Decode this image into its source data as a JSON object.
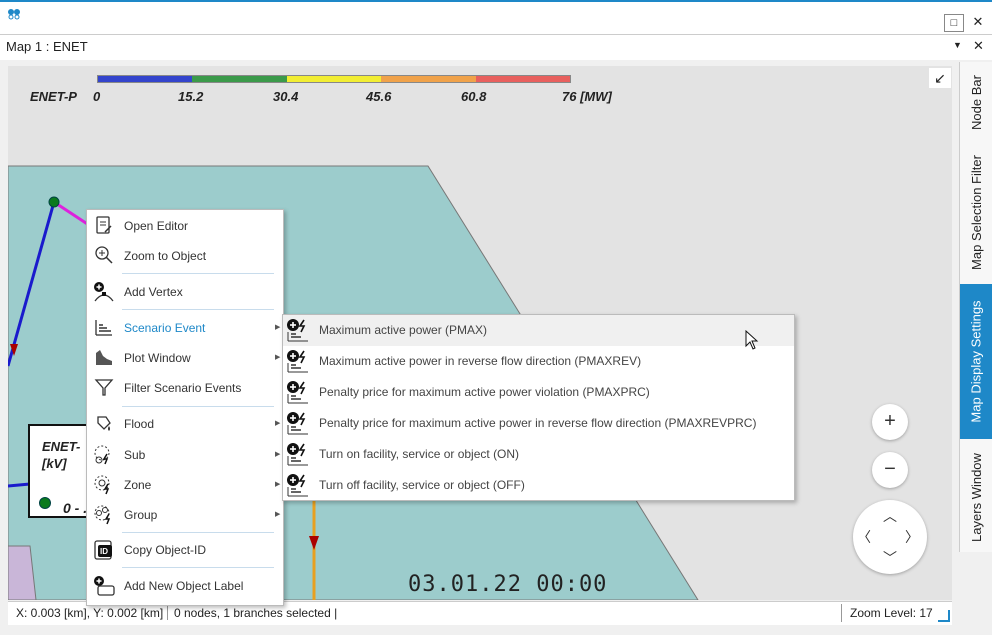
{
  "window": {
    "logo_text": "Int",
    "restore_label": "□",
    "close_label": "✕"
  },
  "document": {
    "title": "Map 1 : ENET",
    "dropdown": "▼",
    "close": "✕"
  },
  "legend": {
    "title": "ENET-P",
    "ticks": [
      "0",
      "15.2",
      "30.4",
      "45.6",
      "60.8",
      "76 [MW]"
    ],
    "colors": [
      "#3344cc",
      "#3b9a4a",
      "#f2ee33",
      "#f0a24a",
      "#e8605e"
    ]
  },
  "node_box": {
    "title_line1": "ENET-",
    "title_line2": "[kV]",
    "range": "0 - ..."
  },
  "map_controls": {
    "collapse_icon": "↙",
    "zoom_in": "+",
    "zoom_out": "−",
    "nav_up": "︿",
    "nav_down": "﹀",
    "nav_left": "〈",
    "nav_right": "〉"
  },
  "timestamp": "03.01.22 00:00",
  "status": {
    "coords": "X: 0.003 [km], Y: 0.002 [km]",
    "selection": "0 nodes, 1 branches selected  |",
    "zoom": "Zoom Level: 17"
  },
  "sidebar": {
    "tabs": [
      "Node Bar",
      "Map Selection Filter",
      "Map Display Settings",
      "Layers Window"
    ],
    "active": "Map Display Settings"
  },
  "context_menu": {
    "items": [
      {
        "label": "Open Editor",
        "icon": "editor-icon",
        "submenu": false
      },
      {
        "label": "Zoom to Object",
        "icon": "zoom-icon",
        "submenu": false
      },
      {
        "label": "Add Vertex",
        "icon": "add-vertex-icon",
        "submenu": false
      },
      {
        "label": "Scenario Event",
        "icon": "scenario-event-icon",
        "submenu": true,
        "highlighted": true
      },
      {
        "label": "Plot Window",
        "icon": "plot-icon",
        "submenu": true
      },
      {
        "label": "Filter Scenario Events",
        "icon": "filter-icon",
        "submenu": false
      },
      {
        "label": "Flood",
        "icon": "flood-icon",
        "submenu": true
      },
      {
        "label": "Sub",
        "icon": "sub-icon",
        "submenu": true
      },
      {
        "label": "Zone",
        "icon": "zone-icon",
        "submenu": true
      },
      {
        "label": "Group",
        "icon": "group-icon",
        "submenu": true
      },
      {
        "label": "Copy Object-ID",
        "icon": "copy-id-icon",
        "submenu": false
      },
      {
        "label": "Add New Object Label",
        "icon": "add-label-icon",
        "submenu": false
      }
    ]
  },
  "submenu": {
    "items": [
      "Maximum active power (PMAX)",
      "Maximum active power in reverse flow direction (PMAXREV)",
      "Penalty price for maximum active power violation (PMAXPRC)",
      "Penalty price for maximum active power in reverse flow direction (PMAXREVPRC)",
      "Turn on facility, service or object (ON)",
      "Turn off facility, service or object (OFF)"
    ]
  }
}
